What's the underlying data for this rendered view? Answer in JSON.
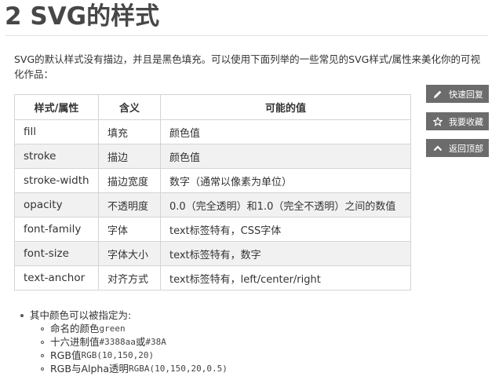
{
  "heading": "2 SVG的样式",
  "intro": "SVG的默认样式没有描边，并且是黑色填充。可以使用下面列举的一些常见的SVG样式/属性来美化你的可视化作品：",
  "table": {
    "headers": [
      "样式/属性",
      "含义",
      "可能的值"
    ],
    "rows": [
      [
        "fill",
        "填充",
        "颜色值"
      ],
      [
        "stroke",
        "描边",
        "颜色值"
      ],
      [
        "stroke-width",
        "描边宽度",
        "数字（通常以像素为单位）"
      ],
      [
        "opacity",
        "不透明度",
        "0.0（完全透明）和1.0（完全不透明）之间的数值"
      ],
      [
        "font-family",
        "字体",
        "text标签特有，CSS字体"
      ],
      [
        "font-size",
        "字体大小",
        "text标签特有，数字"
      ],
      [
        "text-anchor",
        "对齐方式",
        "text标签特有，left/center/right"
      ]
    ]
  },
  "side": {
    "reply": {
      "label": "快速回复",
      "icon": "pencil-icon"
    },
    "favorite": {
      "label": "我要收藏",
      "icon": "star-icon"
    },
    "top": {
      "label": "返回顶部",
      "icon": "chevron-up-icon"
    }
  },
  "notes": {
    "lead": "其中颜色可以被指定为:",
    "items": [
      {
        "text": "命名的颜色 ",
        "code": "green",
        "tail": ""
      },
      {
        "text": "十六进制值 ",
        "code": "#3388aa",
        "tail": "或",
        "code2": "#38A"
      },
      {
        "text": "RGB值 ",
        "code": "RGB(10,150,20)",
        "tail": ""
      },
      {
        "text": "RGB与Alpha透明 ",
        "code": "RGBA(10,150,20,0.5)",
        "tail": ""
      }
    ]
  }
}
